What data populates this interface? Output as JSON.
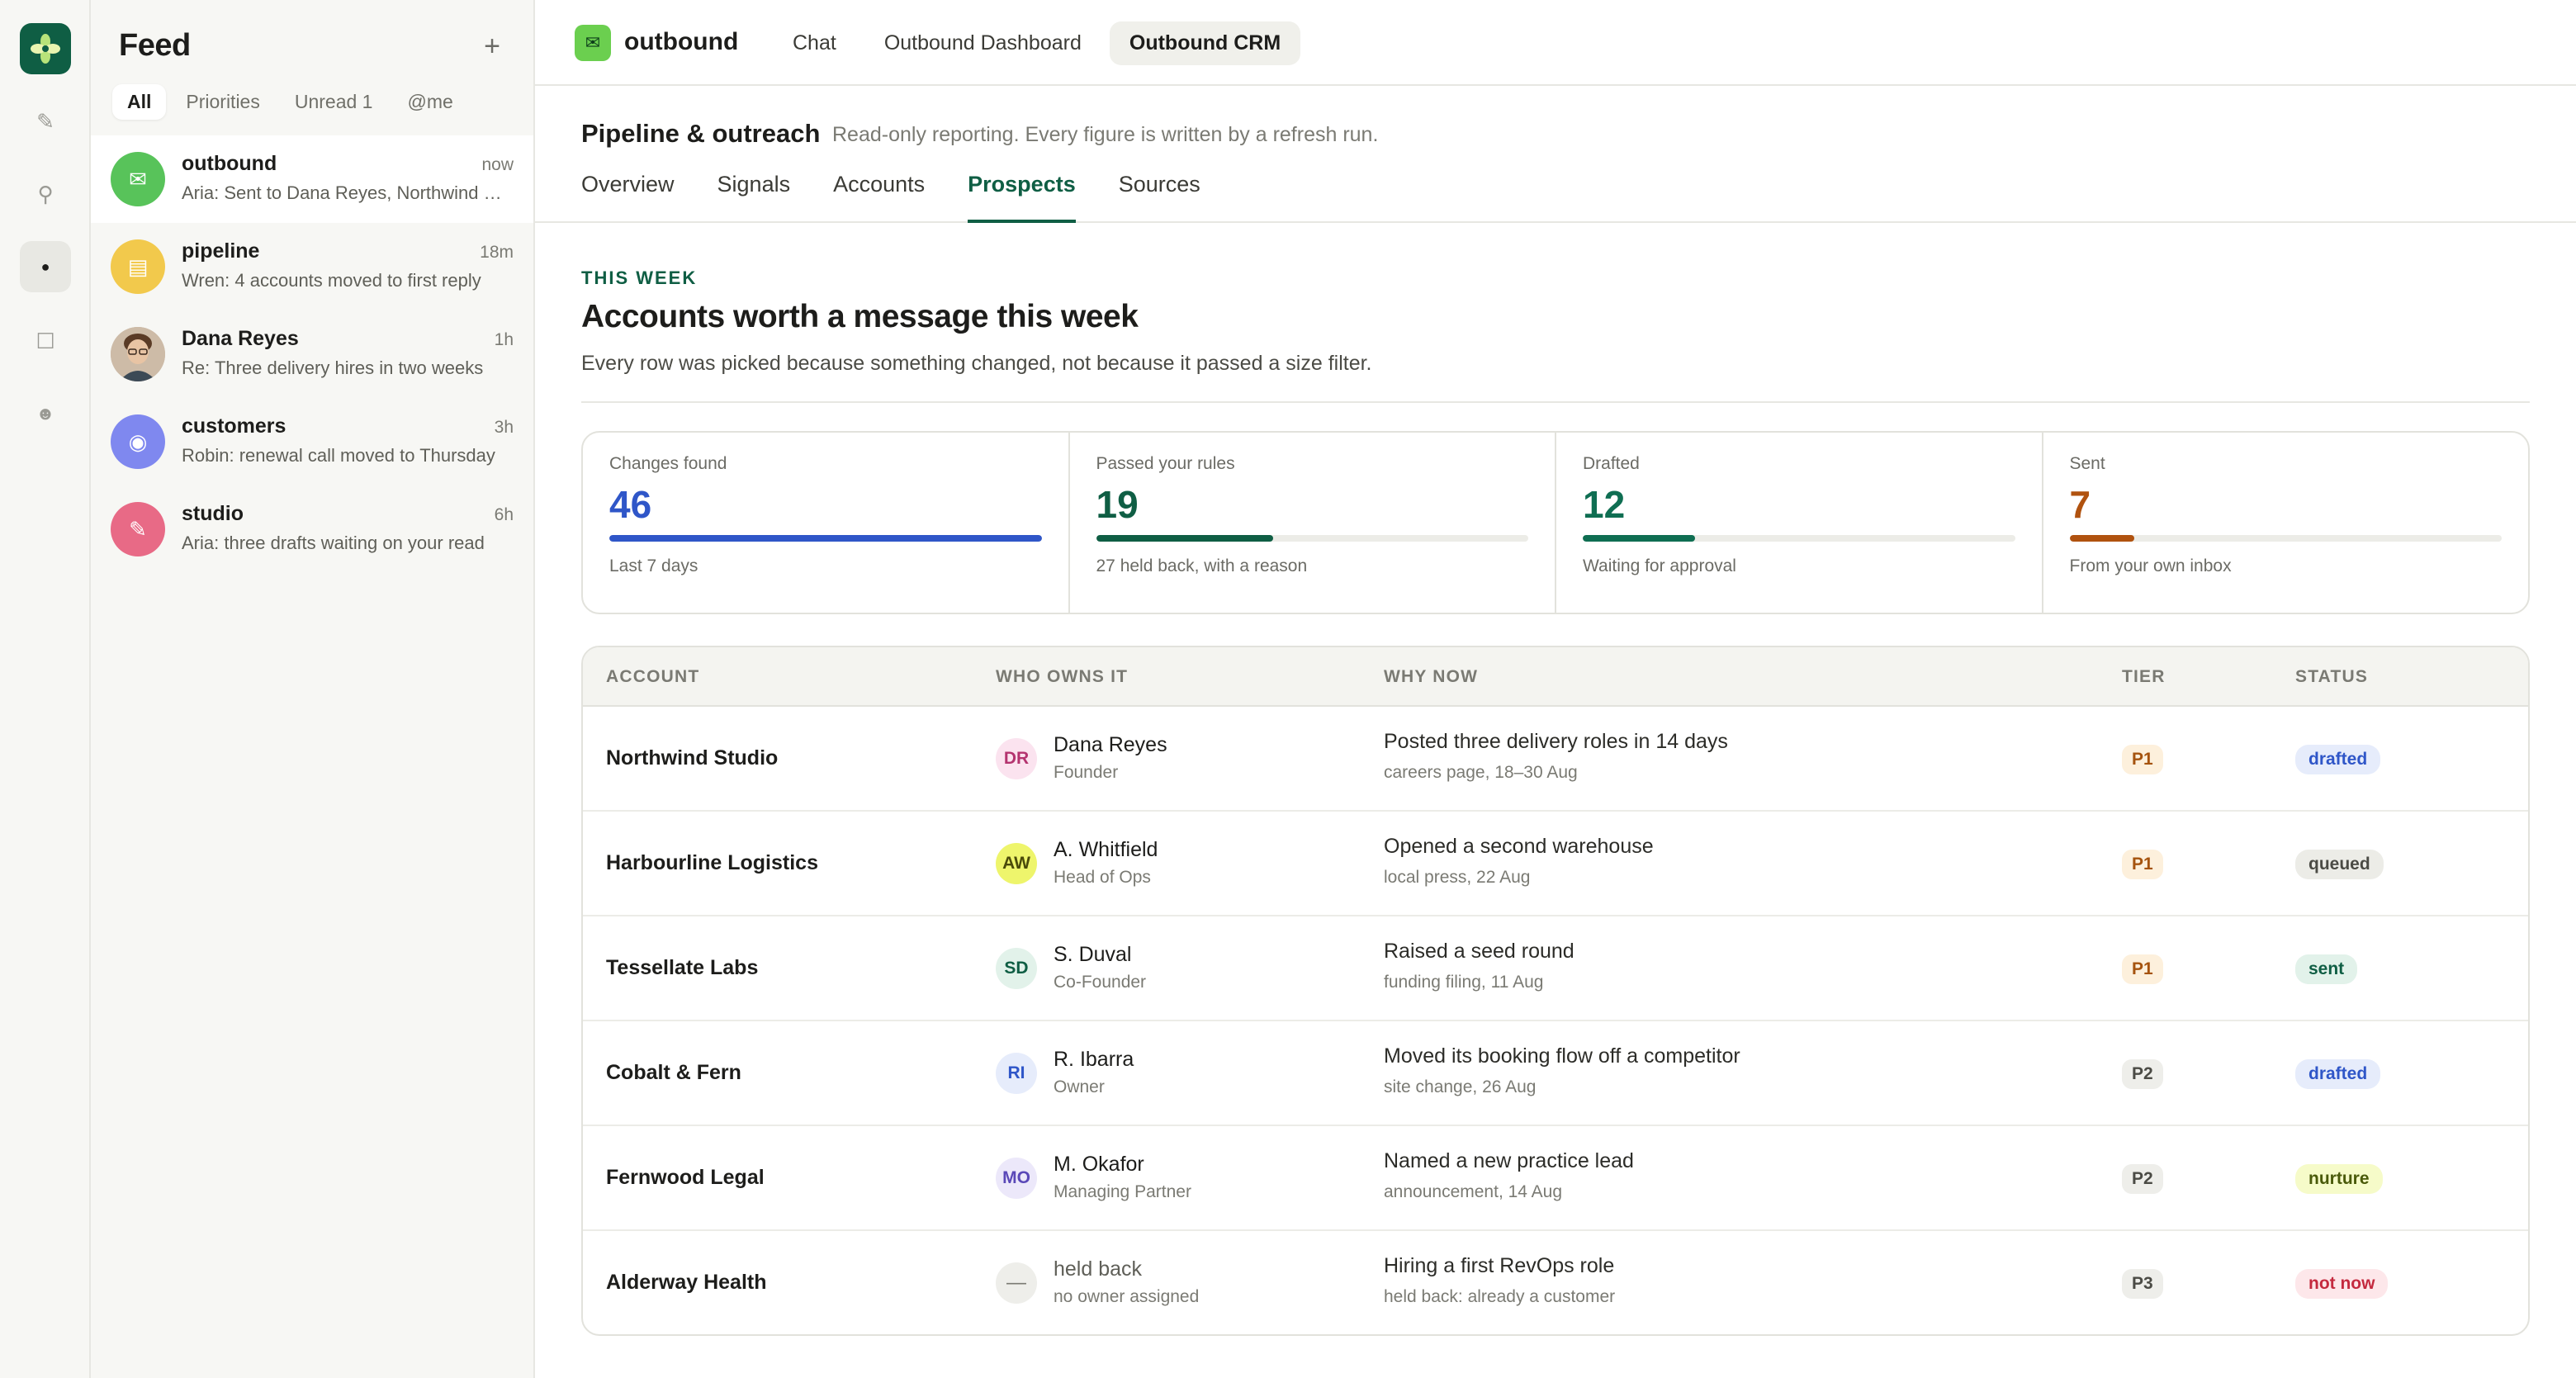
{
  "rail": {
    "items": [
      {
        "icon": "pencil-icon",
        "glyph": "✎"
      },
      {
        "icon": "pin-icon",
        "glyph": "⚲"
      },
      {
        "icon": "dot-icon",
        "glyph": "●"
      },
      {
        "icon": "square-icon",
        "glyph": "☐"
      },
      {
        "icon": "smiley-icon",
        "glyph": "☻"
      }
    ]
  },
  "feed": {
    "title": "Feed",
    "add_glyph": "+",
    "tabs": [
      "All",
      "Priorities",
      "Unread 1",
      "@me"
    ],
    "items": [
      {
        "name": "outbound",
        "time": "now",
        "snippet": "Aria: Sent to Dana Reyes, Northwind Studio",
        "color": "#58c35a",
        "glyph": "✉"
      },
      {
        "name": "pipeline",
        "time": "18m",
        "snippet": "Wren: 4 accounts moved to first reply",
        "color": "#f2c94c",
        "glyph": "▤"
      },
      {
        "name": "Dana Reyes",
        "time": "1h",
        "snippet": "Re: Three delivery hires in two weeks",
        "color": "#8a6a52",
        "glyph": ""
      },
      {
        "name": "customers",
        "time": "3h",
        "snippet": "Robin: renewal call moved to Thursday",
        "color": "#7f88ef",
        "glyph": "◉"
      },
      {
        "name": "studio",
        "time": "6h",
        "snippet": "Aria: three drafts waiting on your read",
        "color": "#e86a86",
        "glyph": "✎"
      }
    ]
  },
  "topbar": {
    "app_glyph": "✉",
    "app_name": "outbound",
    "tabs": [
      "Chat",
      "Outbound Dashboard",
      "Outbound CRM"
    ]
  },
  "page": {
    "title": "Pipeline & outreach",
    "subtitle": "Read-only reporting. Every figure is written by a refresh run.",
    "tabs": [
      "Overview",
      "Signals",
      "Accounts",
      "Prospects",
      "Sources"
    ]
  },
  "section": {
    "eyebrow": "THIS WEEK",
    "heading": "Accounts worth a message this week",
    "subheading": "Every row was picked because something changed, not because it passed a size filter."
  },
  "stats": [
    {
      "label": "Changes found",
      "value": "46",
      "caption": "Last 7 days",
      "fill": 1.0,
      "color": "#2f56c8"
    },
    {
      "label": "Passed your rules",
      "value": "19",
      "caption": "27 held back, with a reason",
      "fill": 0.41,
      "color": "#0f5e44"
    },
    {
      "label": "Drafted",
      "value": "12",
      "caption": "Waiting for approval",
      "fill": 0.26,
      "color": "#0f6e52"
    },
    {
      "label": "Sent",
      "value": "7",
      "caption": "From your own inbox",
      "fill": 0.15,
      "color": "#b0520f"
    }
  ],
  "table": {
    "headers": [
      "ACCOUNT",
      "WHO OWNS IT",
      "WHY NOW",
      "TIER",
      "STATUS"
    ],
    "rows": [
      {
        "account": "Northwind Studio",
        "initials": "DR",
        "owner": "Dana Reyes",
        "role": "Founder",
        "why": "Posted three delivery roles in 14 days",
        "source": "careers page, 18–30 Aug",
        "tier": "P1",
        "status": "drafted",
        "av_bg": "#fbe3ef",
        "av_fg": "#b4336f"
      },
      {
        "account": "Harbourline Logistics",
        "initials": "AW",
        "owner": "A. Whitfield",
        "role": "Head of Ops",
        "why": "Opened a second warehouse",
        "source": "local press, 22 Aug",
        "tier": "P1",
        "status": "queued",
        "av_bg": "#eef56c",
        "av_fg": "#4a4a0a"
      },
      {
        "account": "Tessellate Labs",
        "initials": "SD",
        "owner": "S. Duval",
        "role": "Co-Founder",
        "why": "Raised a seed round",
        "source": "funding filing, 11 Aug",
        "tier": "P1",
        "status": "sent",
        "av_bg": "#e2f2ea",
        "av_fg": "#0f5e44"
      },
      {
        "account": "Cobalt & Fern",
        "initials": "RI",
        "owner": "R. Ibarra",
        "role": "Owner",
        "why": "Moved its booking flow off a competitor",
        "source": "site change, 26 Aug",
        "tier": "P2",
        "status": "drafted",
        "av_bg": "#e6ecfb",
        "av_fg": "#2f56c8"
      },
      {
        "account": "Fernwood Legal",
        "initials": "MO",
        "owner": "M. Okafor",
        "role": "Managing Partner",
        "why": "Named a new practice lead",
        "source": "announcement, 14 Aug",
        "tier": "P2",
        "status": "nurture",
        "av_bg": "#ece8fa",
        "av_fg": "#5a48b8"
      },
      {
        "account": "Alderway Health",
        "initials": "—",
        "owner": "held back",
        "role": "no owner assigned",
        "why": "Hiring a first RevOps role",
        "source": "held back: already a customer",
        "tier": "P3",
        "status": "not now",
        "av_bg": "#eeeeea",
        "av_fg": "#7a7a73"
      }
    ]
  },
  "colors": {
    "accent": "#0f5e44",
    "tier_p1_bg": "#fdf0dc",
    "tier_p1_fg": "#a5530e",
    "tier_other_bg": "#eeeeea",
    "tier_other_fg": "#4b4b45",
    "status": {
      "drafted": {
        "bg": "#e6ecfb",
        "fg": "#2f56c8"
      },
      "queued": {
        "bg": "#ececE7",
        "fg": "#4b4b45"
      },
      "sent": {
        "bg": "#e2f2ea",
        "fg": "#0f5e44"
      },
      "nurture": {
        "bg": "#f6fbc9",
        "fg": "#4a5a0a"
      },
      "not now": {
        "bg": "#fde7ea",
        "fg": "#c42a3f"
      }
    }
  }
}
